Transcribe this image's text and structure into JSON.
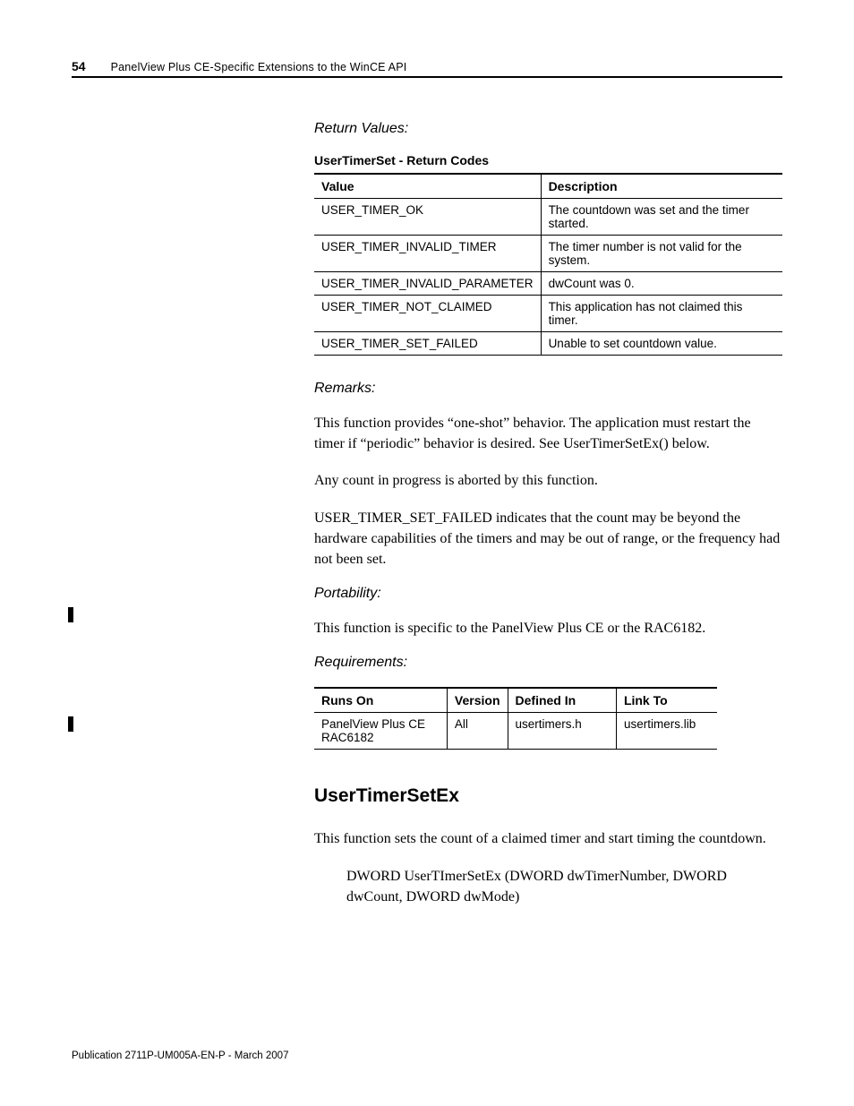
{
  "header": {
    "page_number": "54",
    "title": "PanelView Plus CE-Specific Extensions to the WinCE API"
  },
  "sections": {
    "return_values_heading": "Return Values:",
    "return_table_caption": "UserTimerSet - Return Codes",
    "return_table": {
      "headers": [
        "Value",
        "Description"
      ],
      "rows": [
        [
          "USER_TIMER_OK",
          "The countdown was set and the timer started."
        ],
        [
          "USER_TIMER_INVALID_TIMER",
          "The timer number is not valid for the system."
        ],
        [
          "USER_TIMER_INVALID_PARAMETER",
          "dwCount was 0."
        ],
        [
          "USER_TIMER_NOT_CLAIMED",
          "This application has not claimed this timer."
        ],
        [
          "USER_TIMER_SET_FAILED",
          "Unable to set countdown value."
        ]
      ]
    },
    "remarks_heading": "Remarks:",
    "remarks_p1": "This function provides “one-shot” behavior. The application must restart the timer if “periodic” behavior is desired. See UserTimerSetEx() below.",
    "remarks_p2": "Any count in progress is aborted by this function.",
    "remarks_p3": "USER_TIMER_SET_FAILED indicates that the count may be beyond the hardware capabilities of the timers and may be out of range, or the frequency had not been set.",
    "portability_heading": "Portability:",
    "portability_text": "This function is specific to the PanelView Plus CE or the RAC6182.",
    "requirements_heading": "Requirements:",
    "requirements_table": {
      "headers": [
        "Runs On",
        "Version",
        "Defined In",
        "Link To"
      ],
      "rows": [
        [
          "PanelView Plus CE RAC6182",
          "All",
          "usertimers.h",
          "usertimers.lib"
        ]
      ]
    },
    "next_section_heading": "UserTimerSetEx",
    "next_section_p1": "This function sets the count of a claimed timer and start timing the countdown.",
    "next_section_signature": "DWORD UserTImerSetEx (DWORD dwTimerNumber, DWORD dwCount, DWORD dwMode)"
  },
  "footer": "Publication 2711P-UM005A-EN-P - March 2007"
}
